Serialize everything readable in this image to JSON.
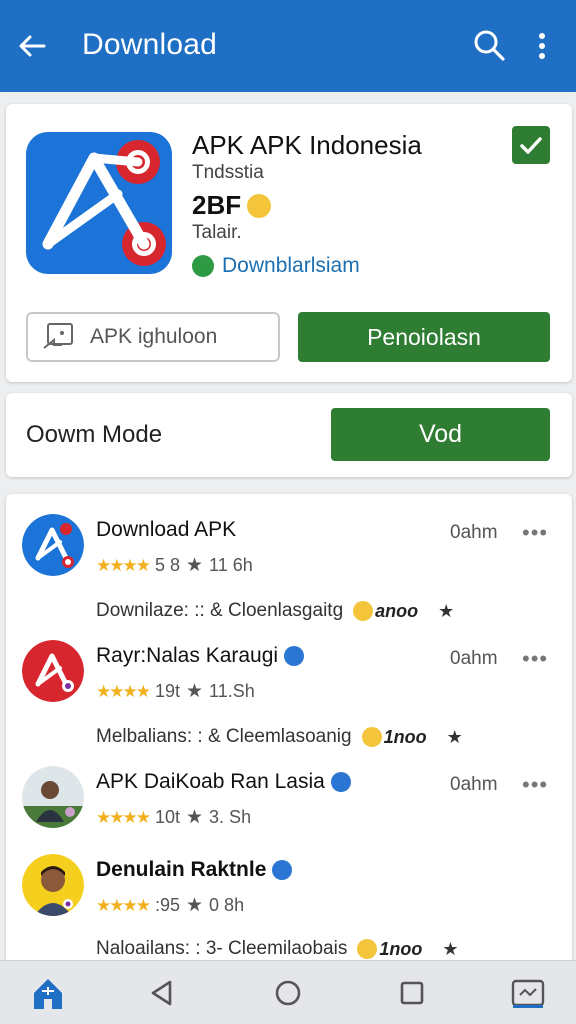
{
  "appbar": {
    "title": "Download",
    "icons": [
      "back-arrow-icon",
      "search-icon",
      "more-vert-icon"
    ],
    "color": "#1f6fc4"
  },
  "hero": {
    "title": "APK APK Indonesia",
    "subtitle": "Tndsstia",
    "size": "2BF",
    "tag": "Talair.",
    "link": "Downblarlsiam",
    "outline_button": "APK ighuloon",
    "primary_button": "Penoiolasn"
  },
  "mode": {
    "label": "Oowm Mode",
    "button": "Vod"
  },
  "list": [
    {
      "name": "Download APK",
      "rating": "5 8",
      "reviews": "11 6h",
      "time": "0ahm",
      "desc": "Downilaze: :: & Cloenlasgaitg",
      "badge": "anoo",
      "verified": false
    },
    {
      "name": "Rayr:Nalas Karaugi",
      "rating": "19t",
      "reviews": "11.Sh",
      "time": "0ahm",
      "desc": "Melbalians: : & Cleemlasoanig",
      "badge": "1noo",
      "verified": true
    },
    {
      "name": "APK DaiKoab Ran Lasia",
      "rating": "10t",
      "reviews": "3. Sh",
      "time": "0ahm",
      "desc": "",
      "badge": "",
      "verified": true
    },
    {
      "name": "Denulain Raktnle",
      "rating": ":95",
      "reviews": "0 8h",
      "time": "",
      "desc": "Naloailans: : 3- Cleemilaobais",
      "badge": "1noo",
      "verified": true
    }
  ],
  "colors": {
    "primary_blue": "#1f6fc4",
    "green": "#2e7d32",
    "star": "#f2b01e"
  },
  "navbar": {
    "items": [
      "home-icon",
      "nav-back-icon",
      "nav-home-circle-icon",
      "nav-recents-icon",
      "nav-apps-icon"
    ]
  }
}
